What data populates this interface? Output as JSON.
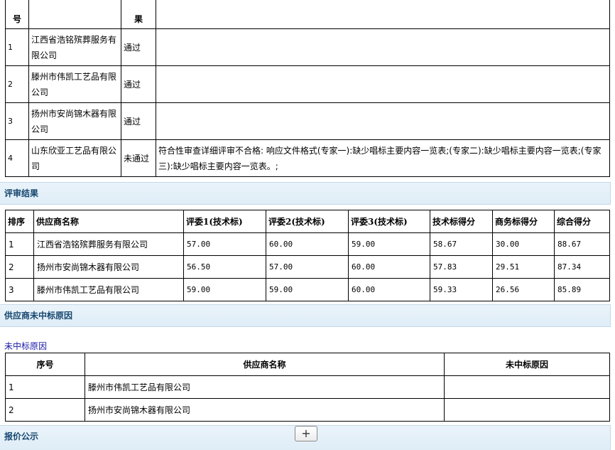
{
  "review_table": {
    "headers": [
      "号",
      "",
      "果",
      ""
    ],
    "rows": [
      {
        "idx": "1",
        "company": "江西省浩铭殡葬服务有限公司",
        "result": "通过",
        "detail": ""
      },
      {
        "idx": "2",
        "company": "滕州市伟凯工艺品有限公司",
        "result": "通过",
        "detail": ""
      },
      {
        "idx": "3",
        "company": "扬州市安尚锦木器有限公司",
        "result": "通过",
        "detail": ""
      },
      {
        "idx": "4",
        "company": "山东欣亚工艺品有限公司",
        "result": "未通过",
        "detail": "符合性审查详细评审不合格: 响应文件格式(专家一):缺少唱标主要内容一览表;(专家二):缺少唱标主要内容一览表;(专家三):缺少唱标主要内容一览表。;"
      }
    ]
  },
  "section_eval": "评审结果",
  "score_table": {
    "headers": [
      "排序",
      "供应商名称",
      "评委1(技术标)",
      "评委2(技术标)",
      "评委3(技术标)",
      "技术标得分",
      "商务标得分",
      "综合得分"
    ],
    "rows": [
      [
        "1",
        "江西省浩铭殡葬服务有限公司",
        "57.00",
        "60.00",
        "59.00",
        "58.67",
        "30.00",
        "88.67"
      ],
      [
        "2",
        "扬州市安尚锦木器有限公司",
        "56.50",
        "57.00",
        "60.00",
        "57.83",
        "29.51",
        "87.34"
      ],
      [
        "3",
        "滕州市伟凯工艺品有限公司",
        "59.00",
        "59.00",
        "60.00",
        "59.33",
        "26.56",
        "85.89"
      ]
    ]
  },
  "section_fail": "供应商未中标原因",
  "reason_link": "未中标原因",
  "reason_table": {
    "headers": [
      "序号",
      "供应商名称",
      "未中标原因"
    ],
    "rows": [
      [
        "1",
        "滕州市伟凯工艺品有限公司",
        ""
      ],
      [
        "2",
        "扬州市安尚锦木器有限公司",
        ""
      ]
    ]
  },
  "section_price": "报价公示",
  "expand_button": "+"
}
